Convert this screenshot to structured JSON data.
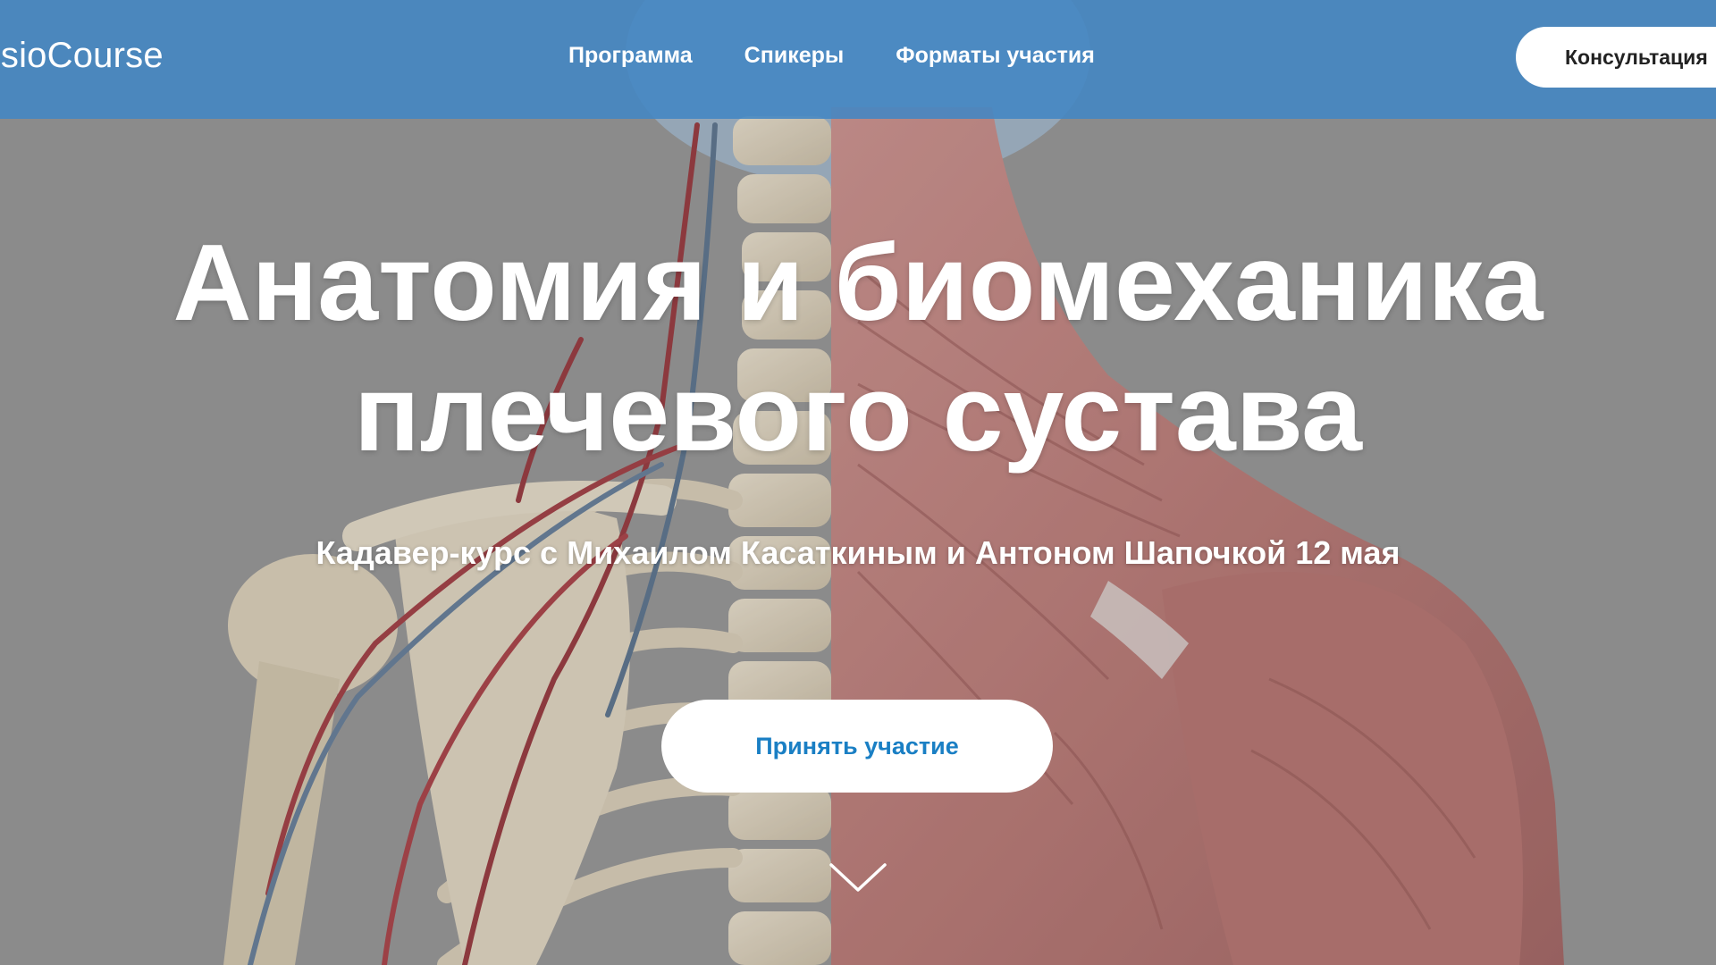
{
  "header": {
    "logo_text": "nesioCourse",
    "nav": [
      {
        "label": "Программа"
      },
      {
        "label": "Спикеры"
      },
      {
        "label": "Форматы участия"
      }
    ],
    "consult_label": "Консультация",
    "background_color": "#4286c4"
  },
  "hero": {
    "title_line1": "Анатомия и биомеханика",
    "title_line2": "плечевого сустава",
    "subtitle": "Кадавер-курс с Михаилом Касаткиным и Антоном Шапочкой 12 мая",
    "cta_label": "Принять участие",
    "cta_text_color": "#1a7fc4",
    "scroll_icon": "chevron-down-icon",
    "background_image": "anatomy-skeleton-muscles-back-illustration"
  }
}
